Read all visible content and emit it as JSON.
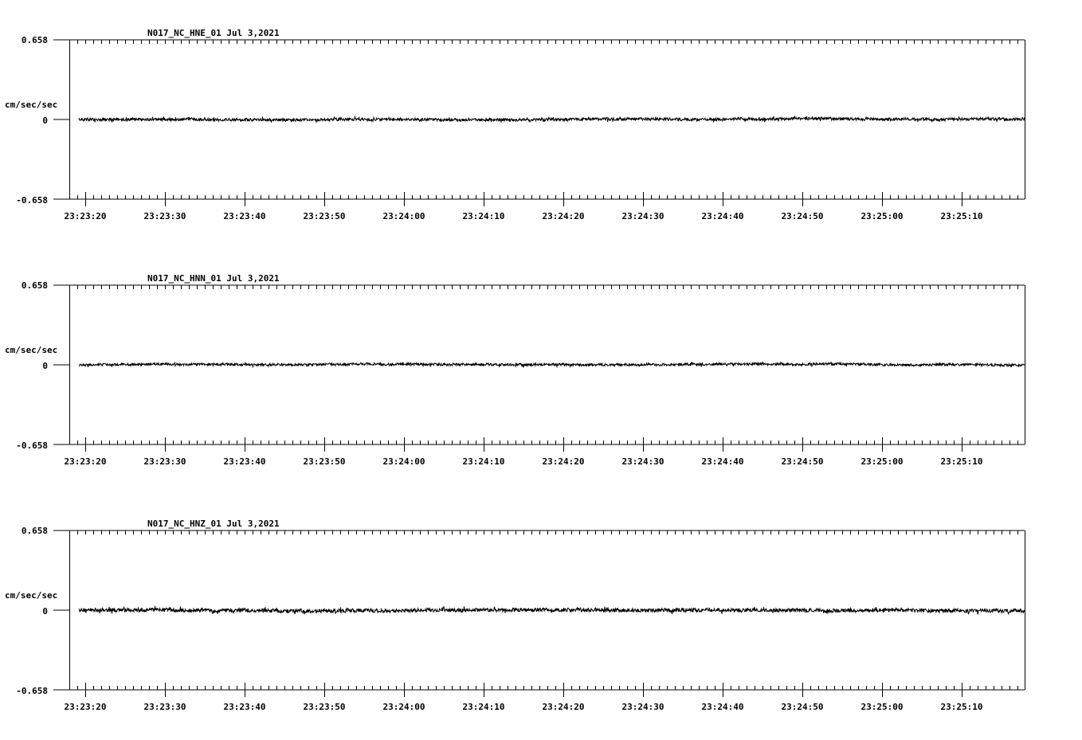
{
  "chart_data": [
    {
      "type": "line",
      "title": "N017_NC_HNE_01   Jul 3,2021",
      "ylabel": "cm/sec/sec",
      "ylim": [
        -0.658,
        0.658
      ],
      "ytick_labels": [
        "0.658",
        "0",
        "-0.658"
      ],
      "xlim_seconds": [
        0,
        120
      ],
      "x_start_time": "23:23:18",
      "xtick_labels": [
        "23:23:20",
        "23:23:30",
        "23:23:40",
        "23:23:50",
        "23:24:00",
        "23:24:10",
        "23:24:20",
        "23:24:30",
        "23:24:40",
        "23:24:50",
        "23:25:00",
        "23:25:10"
      ],
      "signal_start_seconds": 1.2,
      "noise_amplitude": 0.012,
      "grid": false,
      "seed": 11
    },
    {
      "type": "line",
      "title": "N017_NC_HNN_01   Jul 3,2021",
      "ylabel": "cm/sec/sec",
      "ylim": [
        -0.658,
        0.658
      ],
      "ytick_labels": [
        "0.658",
        "0",
        "-0.658"
      ],
      "xlim_seconds": [
        0,
        120
      ],
      "x_start_time": "23:23:18",
      "xtick_labels": [
        "23:23:20",
        "23:23:30",
        "23:23:40",
        "23:23:50",
        "23:24:00",
        "23:24:10",
        "23:24:20",
        "23:24:30",
        "23:24:40",
        "23:24:50",
        "23:25:00",
        "23:25:10"
      ],
      "signal_start_seconds": 1.2,
      "noise_amplitude": 0.01,
      "grid": false,
      "seed": 23
    },
    {
      "type": "line",
      "title": "N017_NC_HNZ_01   Jul 3,2021",
      "ylabel": "cm/sec/sec",
      "ylim": [
        -0.658,
        0.658
      ],
      "ytick_labels": [
        "0.658",
        "0",
        "-0.658"
      ],
      "xlim_seconds": [
        0,
        120
      ],
      "x_start_time": "23:23:18",
      "xtick_labels": [
        "23:23:20",
        "23:23:30",
        "23:23:40",
        "23:23:50",
        "23:24:00",
        "23:24:10",
        "23:24:20",
        "23:24:30",
        "23:24:40",
        "23:24:50",
        "23:25:00",
        "23:25:10"
      ],
      "signal_start_seconds": 1.2,
      "noise_amplitude": 0.016,
      "grid": false,
      "seed": 37
    }
  ]
}
